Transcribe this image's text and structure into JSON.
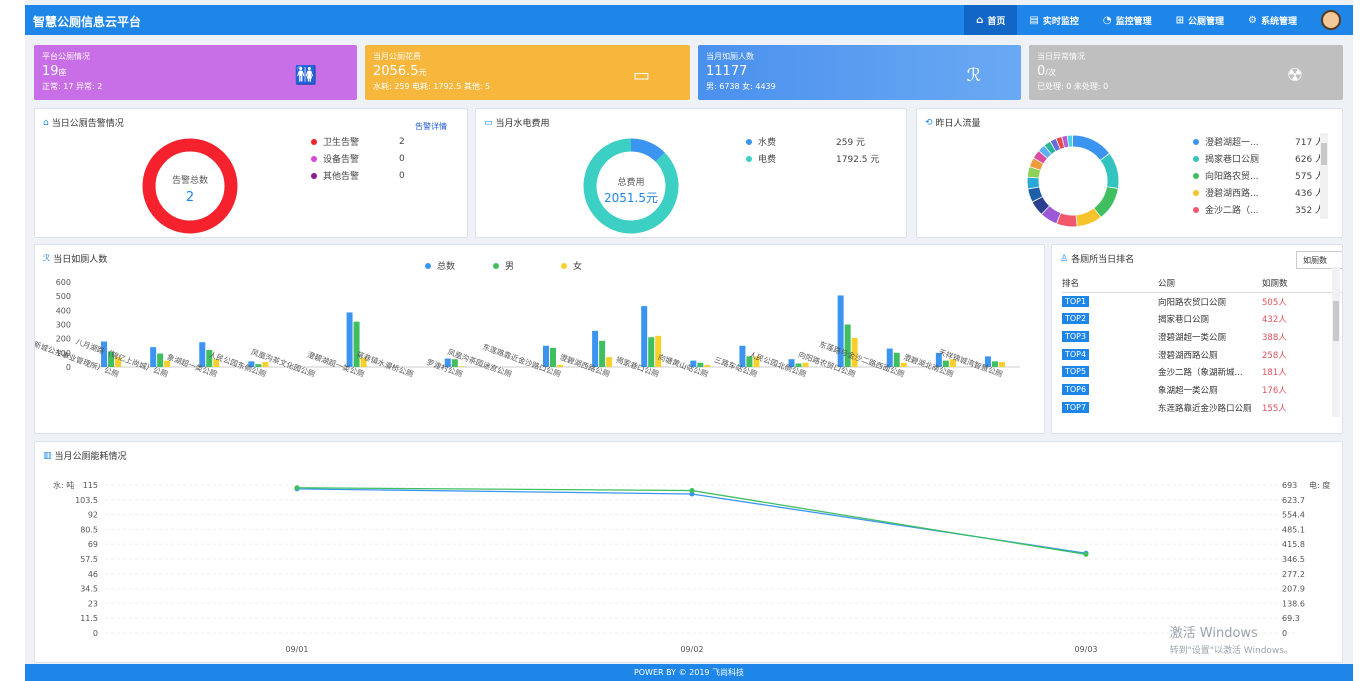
{
  "app": {
    "title": "智慧公厕信息云平台"
  },
  "nav": [
    {
      "icon": "⌂",
      "label": "首页",
      "active": true
    },
    {
      "icon": "▤",
      "label": "实时监控"
    },
    {
      "icon": "◔",
      "label": "监控管理"
    },
    {
      "icon": "⊞",
      "label": "公厕管理"
    },
    {
      "icon": "⚙",
      "label": "系统管理"
    }
  ],
  "cards": [
    {
      "title": "平台公厕情况",
      "value": "19",
      "unit": "座",
      "sub": "正常: 17 异常: 2",
      "icon": "🚻",
      "color": "#c86fe8"
    },
    {
      "title": "当月公厕花费",
      "value": "2056.5",
      "unit": "元",
      "sub": "水耗: 259 电耗: 1792.5 其他: 5",
      "icon": "▭",
      "color": "#f6b73c"
    },
    {
      "title": "当月如厕人数",
      "value": "11177",
      "unit": "",
      "sub": "男: 6738 女: 4439",
      "icon": "ℛ",
      "color": "#4a90ee"
    },
    {
      "title": "当日异常情况",
      "value": "0",
      "unit": "/次",
      "sub": "已处理: 0 未处理: 0",
      "icon": "☢",
      "color": "#bfbfbf"
    }
  ],
  "alarm": {
    "title": "当日公厕告警情况",
    "link": "告警详情",
    "center_label": "告警总数",
    "center_value": "2",
    "items": [
      {
        "label": "卫生告警",
        "value": "2",
        "color": "#f5222d"
      },
      {
        "label": "设备告警",
        "value": "0",
        "color": "#d64ad6"
      },
      {
        "label": "其他告警",
        "value": "0",
        "color": "#8b1c8b"
      }
    ]
  },
  "utility": {
    "title": "当月水电费用",
    "center_label": "总费用",
    "center_value": "2051.5元",
    "items": [
      {
        "label": "水费",
        "value": "259 元",
        "color": "#3b95f0",
        "amount": 259
      },
      {
        "label": "电费",
        "value": "1792.5 元",
        "color": "#3ccfc3",
        "amount": 1792.5
      }
    ]
  },
  "traffic": {
    "title": "昨日人流量",
    "items": [
      {
        "label": "澄碧湖超一...",
        "value": "717 人",
        "color": "#3b95f0"
      },
      {
        "label": "揭家巷口公厕",
        "value": "626 人",
        "color": "#33c4bf"
      },
      {
        "label": "向阳路农贸...",
        "value": "575 人",
        "color": "#3fbf5f"
      },
      {
        "label": "澄碧湖西路...",
        "value": "436 人",
        "color": "#f7c32b"
      },
      {
        "label": "金沙二路（...",
        "value": "352 人",
        "color": "#f0576b"
      }
    ],
    "ring_colors": [
      "#3b95f0",
      "#33c4bf",
      "#3fbf5f",
      "#f7c32b",
      "#f0576b",
      "#9b59d6",
      "#2c3e8f",
      "#1f5fa8",
      "#2aa7d6",
      "#8bd15a",
      "#f09a3c",
      "#d94fa0",
      "#5ab0f0",
      "#2bb59a",
      "#6c6cd9",
      "#e84a4a",
      "#b35dd6",
      "#4ad1e8"
    ],
    "ring_values": [
      717,
      626,
      575,
      436,
      352,
      300,
      260,
      230,
      200,
      180,
      160,
      150,
      130,
      120,
      110,
      100,
      95,
      90
    ]
  },
  "usage_chart": {
    "title": "当日如厕人数",
    "legend": [
      {
        "name": "总数",
        "color": "#3b95f0"
      },
      {
        "name": "男",
        "color": "#3fbf5f"
      },
      {
        "name": "女",
        "color": "#f7d02b"
      }
    ]
  },
  "rank": {
    "title": "各厕所当日排名",
    "select": "如厕数",
    "headers": [
      "排名",
      "公厕",
      "如厕数"
    ],
    "rows": [
      {
        "rank": "TOP1",
        "name": "向阳路农贸口公厕",
        "value": "505人"
      },
      {
        "rank": "TOP2",
        "name": "揭家巷口公厕",
        "value": "432人"
      },
      {
        "rank": "TOP3",
        "name": "澄碧湖超一类公厕",
        "value": "388人"
      },
      {
        "rank": "TOP4",
        "name": "澄碧湖西路公厕",
        "value": "258人"
      },
      {
        "rank": "TOP5",
        "name": "金沙二路（象湖新城...",
        "value": "181人"
      },
      {
        "rank": "TOP6",
        "name": "象湖超一类公厕",
        "value": "176人"
      },
      {
        "rank": "TOP7",
        "name": "东莲路靠近金沙路口公厕",
        "value": "155人"
      }
    ]
  },
  "energy": {
    "title": "当月公厕能耗情况"
  },
  "watermark": {
    "line1": "激活 Windows",
    "line2": "转到\"设置\"以激活 Windows。"
  },
  "footer": "POWER BY © 2019 飞尚科技",
  "chart_data": [
    {
      "type": "bar",
      "title": "当日如厕人数",
      "categories": [
        "金沙二路（象湖新城公共事业管理所）公厕",
        "八月湖路（锦亿上尚城）公厕",
        "象湖超一类公厕",
        "人民公园东侧公厕",
        "凤凰沟茶文化园公厕",
        "澄碧湖超一类公厕",
        "蒋巷镇水漫桥公厕",
        "罗渡村公厕",
        "凤凰沟茶园迷宫公厕",
        "东莲路靠近金沙路口公厕",
        "澄碧湖西路公厕",
        "揭家巷口公厕",
        "向塘黄山站公厕",
        "三路车站公厕",
        "人民公园北侧公厕",
        "向阳路农贸口公厕",
        "东莲路与金沙二路西面公厕",
        "澄碧湖北南公厕",
        "天祥锦城湾智慧公厕"
      ],
      "series": [
        {
          "name": "总数",
          "values": [
            180,
            140,
            175,
            40,
            0,
            385,
            0,
            60,
            0,
            150,
            255,
            430,
            45,
            150,
            55,
            505,
            130,
            100,
            75
          ]
        },
        {
          "name": "男",
          "values": [
            110,
            95,
            120,
            20,
            0,
            320,
            0,
            55,
            0,
            135,
            185,
            210,
            30,
            75,
            25,
            300,
            100,
            45,
            40
          ]
        },
        {
          "name": "女",
          "values": [
            70,
            45,
            55,
            35,
            0,
            65,
            0,
            5,
            0,
            15,
            70,
            220,
            15,
            75,
            30,
            205,
            30,
            55,
            35
          ]
        }
      ],
      "ylim": [
        0,
        600
      ],
      "yticks": [
        "600",
        "500",
        "400",
        "300",
        "200",
        "100",
        "0"
      ]
    },
    {
      "type": "line",
      "title": "当月公厕能耗情况",
      "x": [
        "09/01",
        "09/02",
        "09/03"
      ],
      "ylabel": "水: 吨",
      "y2label": "电: 度",
      "series": [
        {
          "name": "水",
          "axis": "left",
          "values": [
            112,
            108,
            62
          ],
          "color": "#3b95f0"
        },
        {
          "name": "电",
          "axis": "right",
          "values": [
            680,
            667,
            368
          ],
          "color": "#3fbf5f"
        }
      ],
      "ylim": [
        0,
        115
      ],
      "y2lim": [
        0,
        693
      ],
      "yticks": [
        "115",
        "103.5",
        "92",
        "80.5",
        "69",
        "57.5",
        "46",
        "34.5",
        "23",
        "11.5",
        "0"
      ],
      "y2ticks": [
        "693",
        "623.7",
        "554.4",
        "485.1",
        "415.8",
        "346.5",
        "277.2",
        "207.9",
        "138.6",
        "69.3",
        "0"
      ]
    }
  ]
}
